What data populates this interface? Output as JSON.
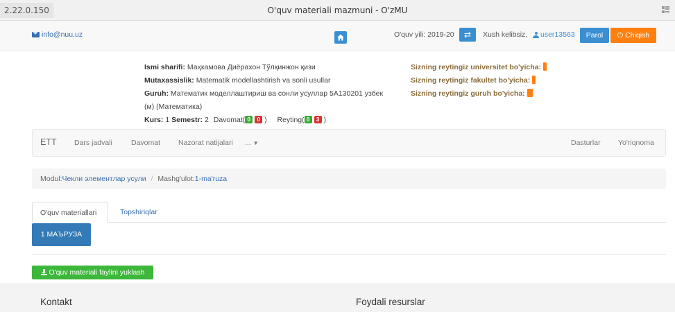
{
  "browser": {
    "url": "2.22.0.150",
    "title": "O'quv materiali mazmuni - O'zMU"
  },
  "topbar": {
    "email": "info@nuu.uz",
    "year": "O'quv yili: 2019-20",
    "welcome": "Xush kelibsiz,",
    "user": "user13563",
    "parol": "Parol",
    "chiqish": "Chiqish"
  },
  "profile": {
    "name_label": "Ismi sharifi:",
    "name": "Маҳкамова Диёрахон Тўлқинжон қизи",
    "spec_label": "Mutaxassislik:",
    "spec": "Matematik modellashtirish va sonli usullar",
    "group_label": "Guruh:",
    "group": "Математик моделлаштириш ва сонли усуллар 5А130201 узбек (м) (Математика)",
    "kurs_label": "Kurs:",
    "kurs": "1",
    "semestr_label": "Semestr:",
    "semestr": "2",
    "davomat_label": "Davomat(",
    "davomat_green": "0",
    "davomat_red": "0",
    "reyting_label": "Reyting(",
    "reyting_green": "0",
    "reyting_red": "3",
    "close_paren": ")"
  },
  "ratings": {
    "university": "Sizning reytingiz universitet bo'yicha:",
    "faculty": "Sizning reytingiz fakultet bo'yicha:",
    "group": "Sizning reytingiz guruh bo'yicha:"
  },
  "subnav": {
    "brand": "ETT",
    "items": [
      "Dars jadvali",
      "Davomat",
      "Nazorat natijalari",
      "..."
    ],
    "right": [
      "Dasturlar",
      "Yo'riqnoma"
    ]
  },
  "breadcrumb": {
    "modul_label": "Modul:",
    "modul": "Чекли элементлар усули",
    "separator": "/",
    "mashgulot_label": "Mashg'ulot:",
    "mashgulot": "1-ma'ruza"
  },
  "tabs": {
    "active": "O'quv materiallari",
    "inactive": "Topshiriqlar"
  },
  "content": {
    "lecture_button": "1 МАЪРУЗА",
    "download_button": "O'quv materiali faylini yuklash"
  },
  "footer": {
    "kontakt": "Kontakt",
    "resurslar": "Foydali resurslar"
  },
  "colors": {
    "primary": "#337ab7",
    "orange": "#ff7f10",
    "green": "#3cb73a",
    "red": "#d9332f"
  }
}
